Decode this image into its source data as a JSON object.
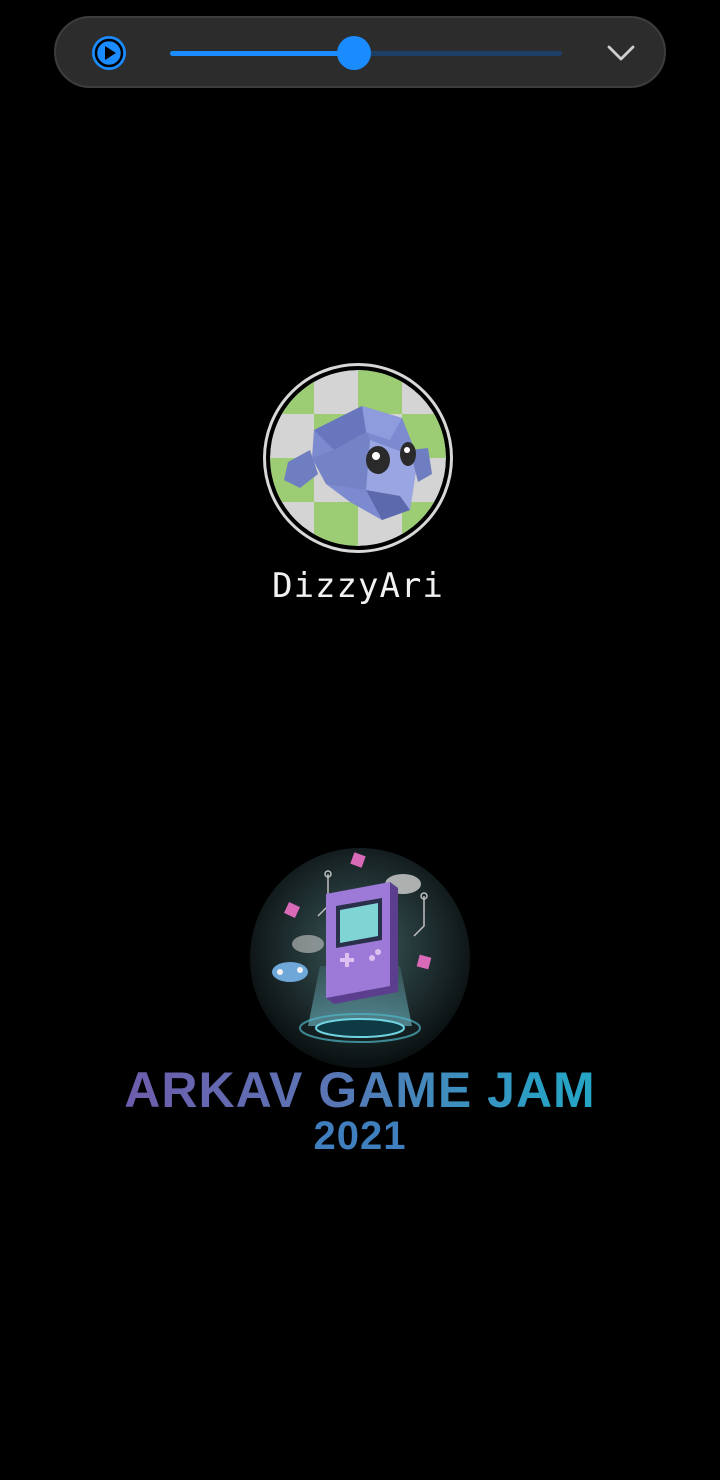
{
  "player": {
    "progress": 0.47,
    "play_icon": "play-icon",
    "collapse_icon": "chevron-down-icon",
    "accent_color": "#1a8cff"
  },
  "profile": {
    "username": "DizzyAri",
    "avatar_icon": "monkey-head-avatar"
  },
  "logo": {
    "title": "ARKAV GAME JAM",
    "year": "2021",
    "emblem_icon": "handheld-console-emblem",
    "colors": {
      "title_start": "#7a4fa8",
      "title_end": "#1cb3c8",
      "year": "#3f7fbe"
    }
  }
}
